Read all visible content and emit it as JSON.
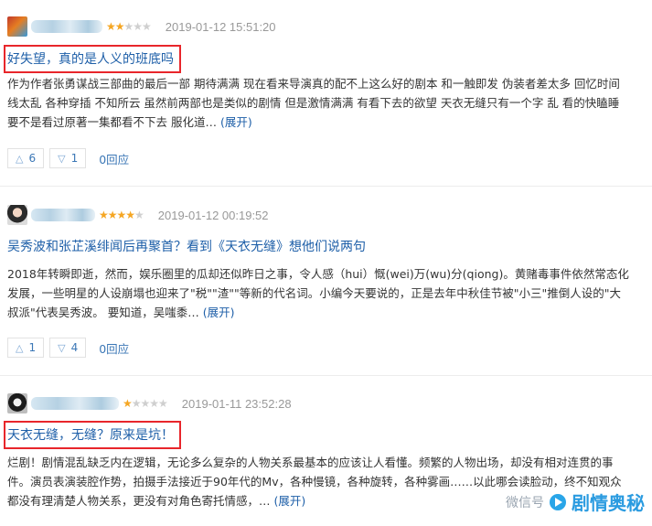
{
  "reviews": [
    {
      "stars_on": "★★",
      "stars_off": "★★★",
      "time": "2019-01-12 15:51:20",
      "title": "好失望，真的是人义的班底吗",
      "body": "作为作者张勇谋战三部曲的最后一部 期待满满 现在看来导演真的配不上这么好的剧本 和一触即发 伪装者差太多 回忆时间线太乱 各种穿插 不知所云 虽然前两部也是类似的剧情 但是激情满满 有看下去的欲望 天衣无缝只有一个字 乱 看的快瞌睡 要不是看过原著一集都看不下去 服化道…",
      "more": "(展开)",
      "up": "6",
      "down": "1",
      "reply": "0回应"
    },
    {
      "stars_on": "★★★★",
      "stars_off": "★",
      "time": "2019-01-12 00:19:52",
      "title": "吴秀波和张芷溪绯闻后再聚首？看到《天衣无缝》想他们说两句",
      "body": "2018年转瞬即逝，然而，娱乐圈里的瓜却还似昨日之事，令人感（hui）慨(wei)万(wu)分(qiong)。黄赌毒事件依然常态化发展，一些明星的人设崩塌也迎来了\"税\"\"渣\"\"等新的代名词。小编今天要说的，正是去年中秋佳节被\"小三\"推倒人设的\"大叔派\"代表吴秀波。 要知道，吴嗤黍…",
      "more": "(展开)",
      "up": "1",
      "down": "4",
      "reply": "0回应"
    },
    {
      "stars_on": "★",
      "stars_off": "★★★★",
      "time": "2019-01-11 23:52:28",
      "title": "天衣无缝，无缝？原来是坑！",
      "body": "烂剧！剧情混乱缺乏内在逻辑，无论多么复杂的人物关系最基本的应该让人看懂。频繁的人物出场，却没有相对连贯的事件。演员表演装腔作势，拍摄手法接近于90年代的Mv，各种慢镜，各种旋转，各种雾画……以此哪会读脸动，终不知观众都没有理清楚人物关系，更没有对角色寄托情感，…",
      "more": "(展开)",
      "up": "",
      "down": "",
      "reply": ""
    }
  ],
  "watermark": {
    "wechat": "微信号",
    "brand": "剧情奥秘"
  },
  "colors": {
    "link": "#1e5fa8",
    "highlight_box": "#e8262b",
    "star_on": "#f5a623",
    "star_off": "#cfcfcf"
  }
}
